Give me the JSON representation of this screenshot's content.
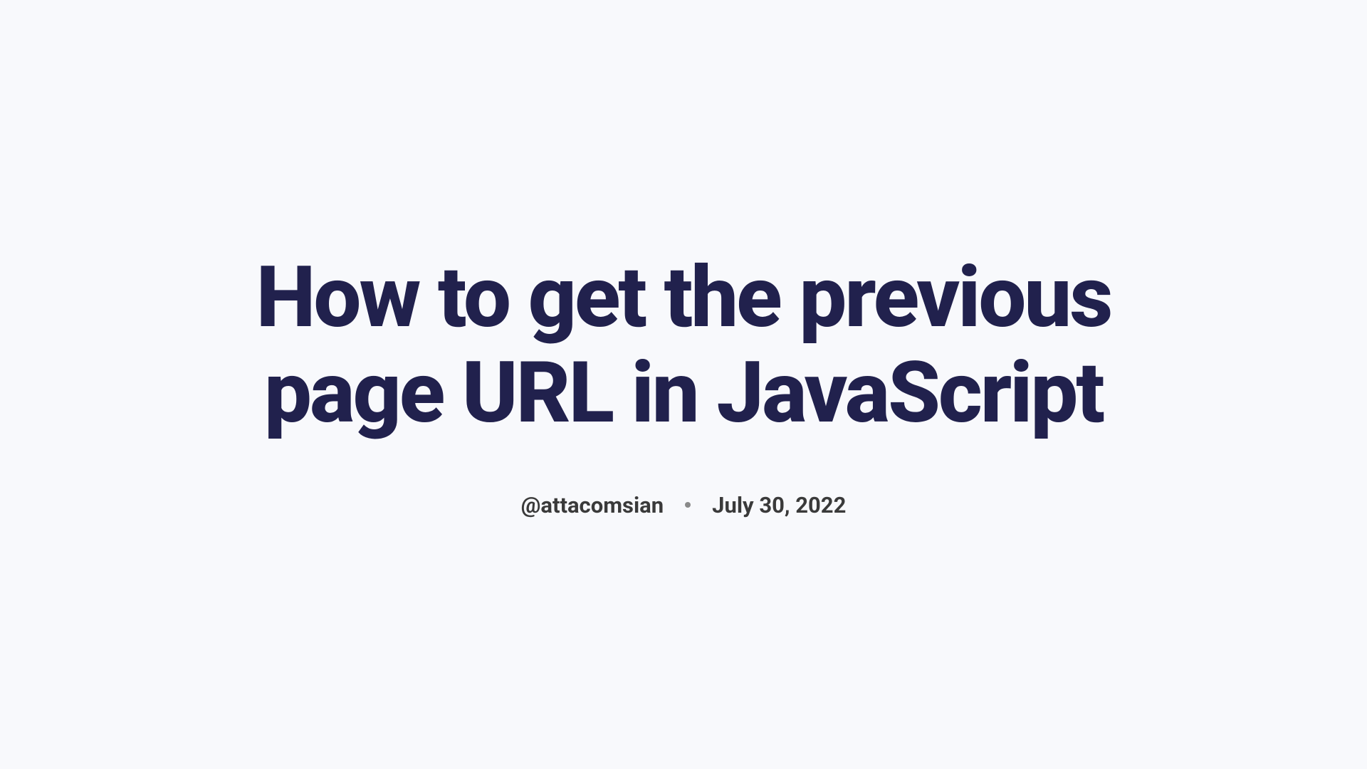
{
  "article": {
    "title": "How to get the previous page URL in JavaScript",
    "author": "@attacomsian",
    "date": "July 30, 2022"
  }
}
